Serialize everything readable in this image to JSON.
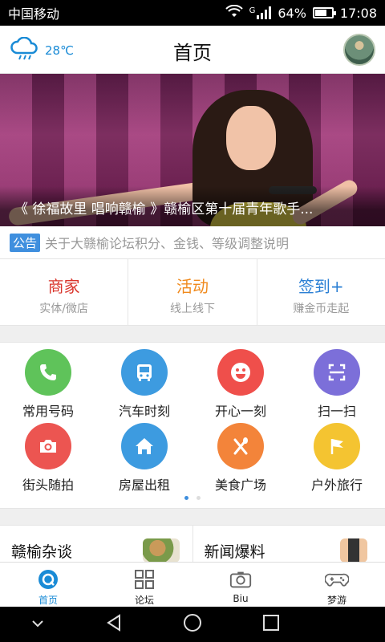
{
  "status_bar": {
    "carrier": "中国移动",
    "signal": "G",
    "battery": "64%",
    "battery_level": 0.64,
    "time": "17:08"
  },
  "header": {
    "weather": "28℃",
    "title": "首页"
  },
  "banner": {
    "caption": "《 徐福故里 唱响赣榆 》赣榆区第十届青年歌手..."
  },
  "notice": {
    "tag": "公告",
    "text": "关于大赣榆论坛积分、金钱、等级调整说明"
  },
  "quick_links": [
    {
      "title": "商家",
      "subtitle": "实体/微店",
      "color": "#d9342b"
    },
    {
      "title": "活动",
      "subtitle": "线上线下",
      "color": "#f08a1d"
    },
    {
      "title": "签到+",
      "subtitle": "赚金币走起",
      "color": "#2a7fd4"
    }
  ],
  "services": [
    {
      "label": "常用号码",
      "icon": "phone-icon",
      "color": "#5fc35a"
    },
    {
      "label": "汽车时刻",
      "icon": "bus-icon",
      "color": "#3d9be0"
    },
    {
      "label": "开心一刻",
      "icon": "smile-icon",
      "color": "#ef4f4b"
    },
    {
      "label": "扫一扫",
      "icon": "scan-icon",
      "color": "#7c6fd9"
    },
    {
      "label": "街头随拍",
      "icon": "camera-icon",
      "color": "#ec5551"
    },
    {
      "label": "房屋出租",
      "icon": "house-icon",
      "color": "#3d9be0"
    },
    {
      "label": "美食广场",
      "icon": "utensils-icon",
      "color": "#f3843a"
    },
    {
      "label": "户外旅行",
      "icon": "flag-icon",
      "color": "#f4c431"
    }
  ],
  "cards": [
    {
      "title": "赣榆杂谈"
    },
    {
      "title": "新闻爆料"
    }
  ],
  "tabs": [
    {
      "label": "首页",
      "icon": "home-icon"
    },
    {
      "label": "论坛",
      "icon": "grid-icon"
    },
    {
      "label": "Biu",
      "icon": "camera-icon"
    },
    {
      "label": "梦游",
      "icon": "gamepad-icon"
    }
  ]
}
